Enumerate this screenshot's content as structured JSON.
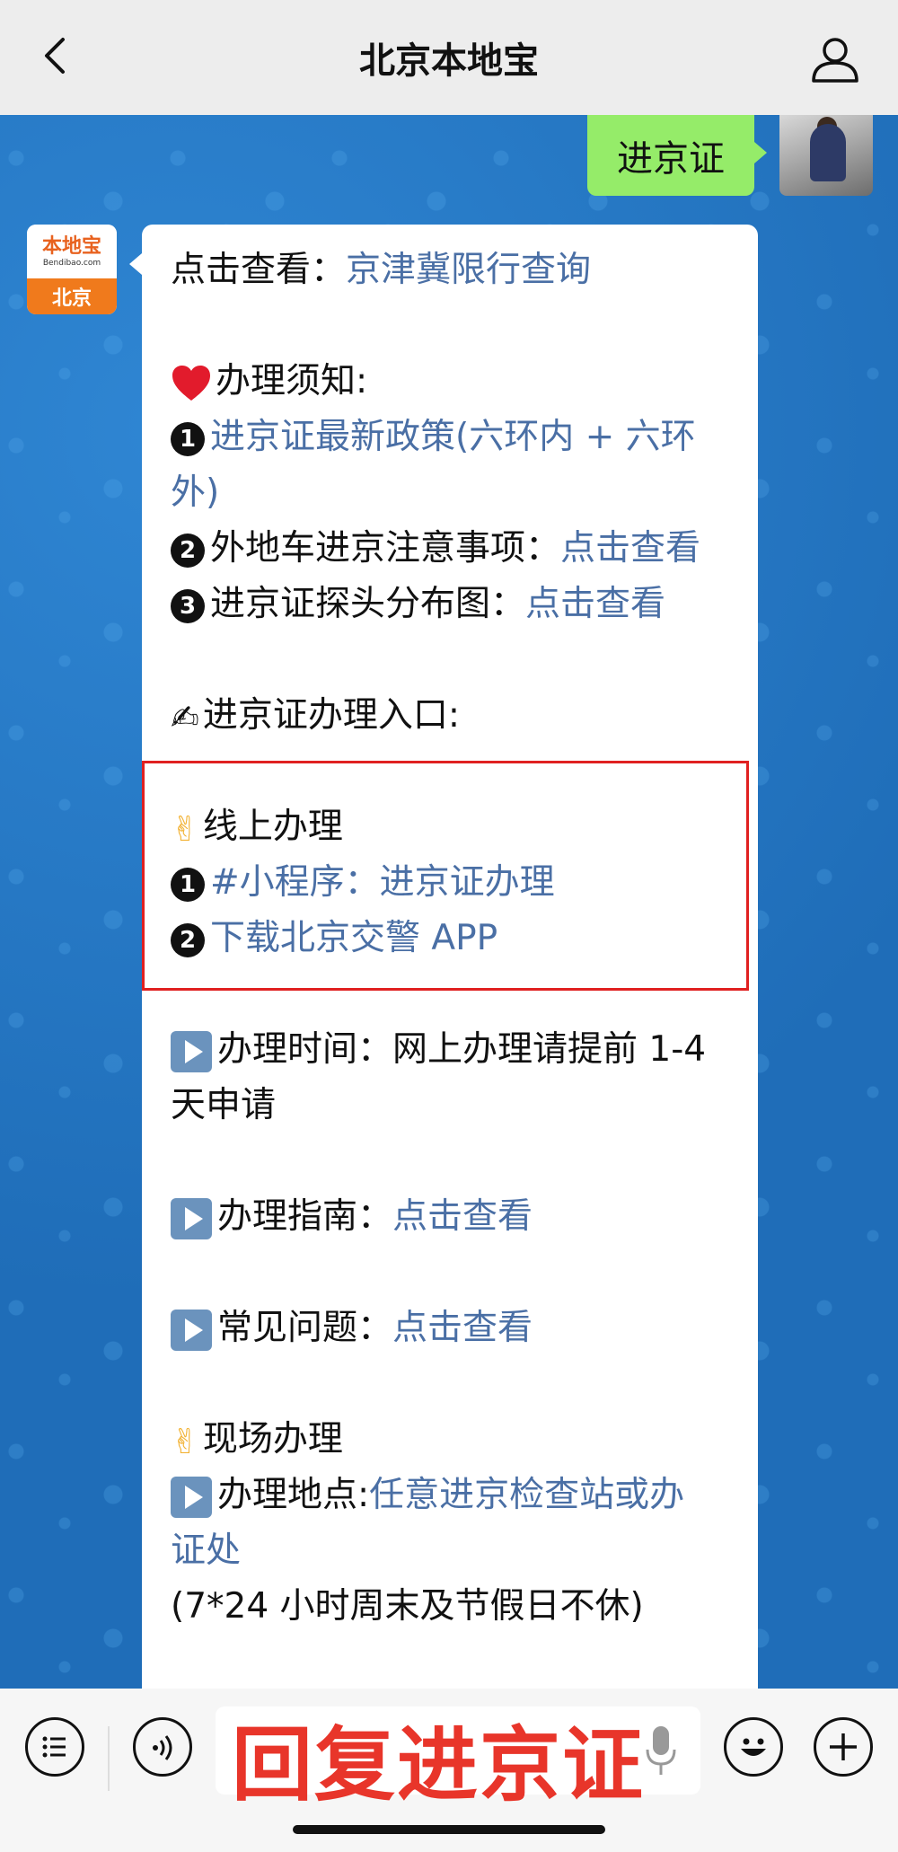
{
  "header": {
    "title": "北京本地宝"
  },
  "my_message": "进京证",
  "bot_avatar": {
    "logo_text": "本地宝",
    "sub_text": "Bendibao.com",
    "city": "北京"
  },
  "message": {
    "line1_prefix": "点击查看：",
    "line1_link": "京津冀限行查询",
    "notice_title": "办理须知:",
    "item1_link_a": "进京证最新政策(六环内 + 六环",
    "item1_link_b": "外)",
    "item2_text": "外地车进京注意事项：",
    "item2_link": "点击查看",
    "item3_text": "进京证探头分布图：",
    "item3_link": "点击查看",
    "entry_title": "进京证办理入口:",
    "online_title": "线上办理",
    "online_1": "#小程序：进京证办理",
    "online_2": "下载北京交警 APP",
    "time_label": "办理时间：网上办理请提前 1-4",
    "time_label_b": "天申请",
    "guide_label": "办理指南：",
    "guide_link": "点击查看",
    "faq_label": "常见问题：",
    "faq_link": "点击查看",
    "onsite_title": "现场办理",
    "location_label": "办理地点:",
    "location_link_a": "任意进京检查站或办",
    "location_link_b": "证处",
    "hours": "(7*24 小时周末及节假日不休)",
    "num1": "1",
    "num2": "2",
    "num3": "3"
  },
  "bottom": {
    "overlay_text": "回复进京证"
  },
  "colors": {
    "link": "#4a6fa5",
    "bubble_mine": "#95ec69",
    "highlight_border": "#e02020",
    "overlay_text": "#e8352a"
  },
  "icons": [
    "back-icon",
    "profile-icon",
    "heart-icon",
    "writing-hand-icon",
    "victory-hand-icon",
    "play-icon",
    "list-icon",
    "voice-icon",
    "mic-icon",
    "emoji-icon",
    "plus-icon"
  ]
}
